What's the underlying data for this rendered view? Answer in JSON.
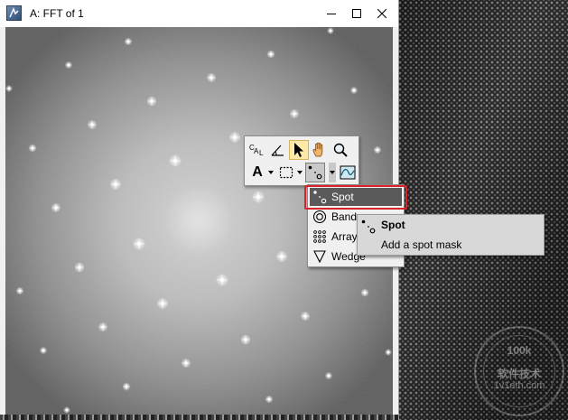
{
  "window": {
    "title": "A: FFT of 1",
    "icon": "dm-app-icon"
  },
  "title_controls": [
    {
      "name": "minimize",
      "icon": "minimize-icon"
    },
    {
      "name": "maximize",
      "icon": "maximize-icon"
    },
    {
      "name": "close",
      "icon": "close-icon"
    }
  ],
  "tool_palette": {
    "row1": [
      {
        "name": "calibration-tool",
        "icon": "cal-icon",
        "label": "CAL"
      },
      {
        "name": "angle-tool",
        "icon": "angle-icon"
      },
      {
        "name": "selection-tool",
        "icon": "pointer-arrow-icon",
        "selected": true
      },
      {
        "name": "pan-tool",
        "icon": "hand-icon"
      },
      {
        "name": "zoom-tool",
        "icon": "magnifier-icon"
      }
    ],
    "row2": [
      {
        "name": "text-tool",
        "icon": "text-a-icon",
        "label": "A"
      },
      {
        "name": "roi-tool",
        "icon": "dashed-rect-icon"
      },
      {
        "name": "mask-tool",
        "icon": "spot-mask-icon",
        "active": true
      },
      {
        "name": "profile-tool",
        "icon": "line-profile-icon"
      }
    ]
  },
  "mask_menu": {
    "items": [
      {
        "label": "Spot",
        "icon": "spot-mask-icon",
        "highlighted": true
      },
      {
        "label": "Band",
        "icon": "band-mask-icon"
      },
      {
        "label": "Array",
        "icon": "array-mask-icon"
      },
      {
        "label": "Wedge",
        "icon": "wedge-mask-icon"
      }
    ]
  },
  "tooltip": {
    "title": "Spot",
    "description": "Add a spot mask"
  },
  "watermark": {
    "top": "100k",
    "middle": "软件技术",
    "bottom": "1v1eth.com"
  },
  "colors": {
    "highlight_border": "#d8232a",
    "menu_highlight": "#5a5a5a",
    "tooltip_bg": "#d8d8d8",
    "selected_tool": "#ffe9a8"
  }
}
